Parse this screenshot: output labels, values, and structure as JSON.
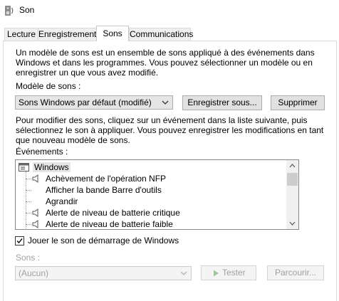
{
  "window": {
    "title": "Son"
  },
  "tabs": [
    {
      "label": "Lecture"
    },
    {
      "label": "Enregistrement"
    },
    {
      "label": "Sons"
    },
    {
      "label": "Communications"
    }
  ],
  "scheme": {
    "description_line1": "Un modèle de sons est un ensemble de sons appliqué à des événements dans",
    "description_line2": "Windows et dans les programmes. Vous pouvez sélectionner un modèle ou en",
    "description_line3": "enregistrer un que vous avez modifié.",
    "label": "Modèle de sons :",
    "selected": "Sons Windows par défaut (modifié)",
    "save_button": "Enregistrer sous...",
    "delete_button": "Supprimer"
  },
  "events": {
    "instructions_line1": "Pour modifier des sons, cliquez sur un événement dans la liste suivante, puis",
    "instructions_line2": "sélectionnez le son à appliquer. Vous pouvez enregistrer les modifications en tant",
    "instructions_line3": "que nouveau modèle de sons.",
    "label": "Événements :",
    "group": "Windows",
    "items": [
      {
        "label": "Achèvement de l'opération NFP",
        "has_sound": true
      },
      {
        "label": "Afficher la bande Barre d'outils",
        "has_sound": false
      },
      {
        "label": "Agrandir",
        "has_sound": false
      },
      {
        "label": "Alerte de niveau de batterie critique",
        "has_sound": true
      },
      {
        "label": "Alerte de niveau de batterie faible",
        "has_sound": true
      }
    ]
  },
  "startup": {
    "label": "Jouer le son de démarrage de Windows",
    "checked": true
  },
  "sounds": {
    "label": "Sons :",
    "selected": "(Aucun)",
    "test_button": "Tester",
    "browse_button": "Parcourir..."
  },
  "icons": {
    "app": "speaker-settings-icon",
    "group": "windows-computer-icon",
    "event_sound": "speaker-icon",
    "dropdown": "chevron-down-icon",
    "play": "play-icon",
    "scroll_up": "arrow-up-icon",
    "scroll_down": "arrow-down-icon"
  }
}
